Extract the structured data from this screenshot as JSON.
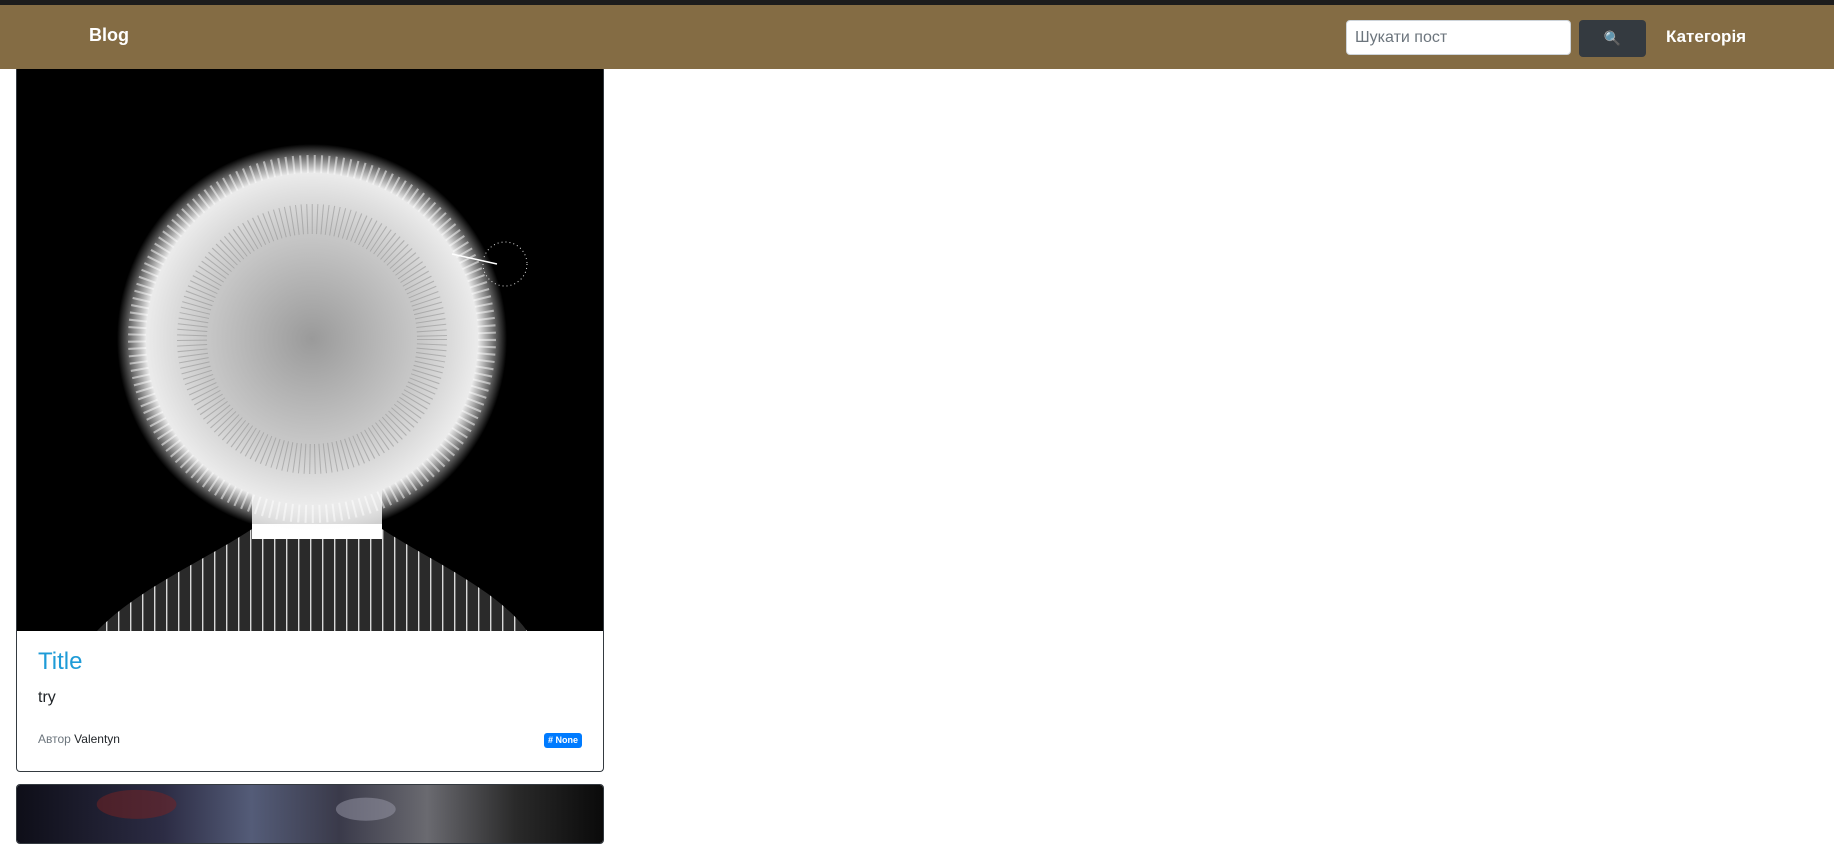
{
  "navbar": {
    "brand": "Blog",
    "search_placeholder": "Шукати пост",
    "search_button_icon": "🔍",
    "category_link": "Категорія",
    "background_color": "#846c44"
  },
  "posts": [
    {
      "title": "Title",
      "text": "try",
      "author_label": "Автор",
      "author_name": "Valentyn",
      "tag": "# None",
      "image": "dandelion-head-portrait"
    },
    {
      "image": "blurred-photo"
    }
  ],
  "colors": {
    "title_link": "#1e9bd7",
    "badge": "#007bff",
    "search_button": "#343a40"
  }
}
